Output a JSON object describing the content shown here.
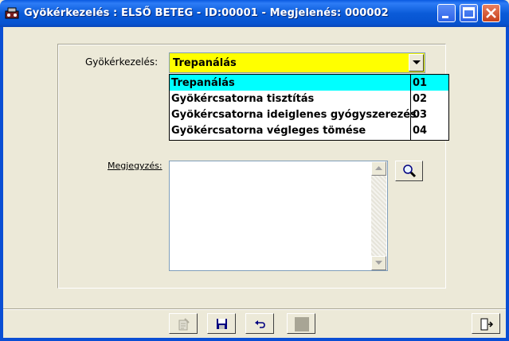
{
  "window": {
    "title": "Gyökérkezelés : ELSŐ BETEG - ID:00001 - Megjelenés: 000002"
  },
  "form": {
    "treatment_label": "Gyökérkezelés:",
    "treatment_value": "Trepanálás",
    "note_label": "Megjegyzés:",
    "note_value": ""
  },
  "dropdown": {
    "items": [
      {
        "name": "Trepanálás",
        "code": "01",
        "selected": true
      },
      {
        "name": "Gyökércsatorna tisztítás",
        "code": "02",
        "selected": false
      },
      {
        "name": "Gyökércsatorna ideiglenes gyógyszerezés",
        "code": "03",
        "selected": false
      },
      {
        "name": "Gyökércsatorna végleges tömése",
        "code": "04",
        "selected": false
      }
    ]
  },
  "colors": {
    "combo_bg": "#ffff00",
    "selection_bg": "#00ffff",
    "titlebar": "#0a5bd8"
  },
  "icons": {
    "title": "app-icon",
    "search": "magnifier-icon",
    "edit": "edit-icon",
    "save": "floppy-disk-icon",
    "undo": "undo-icon",
    "blank": "blank-button-icon",
    "exit": "exit-door-icon"
  }
}
